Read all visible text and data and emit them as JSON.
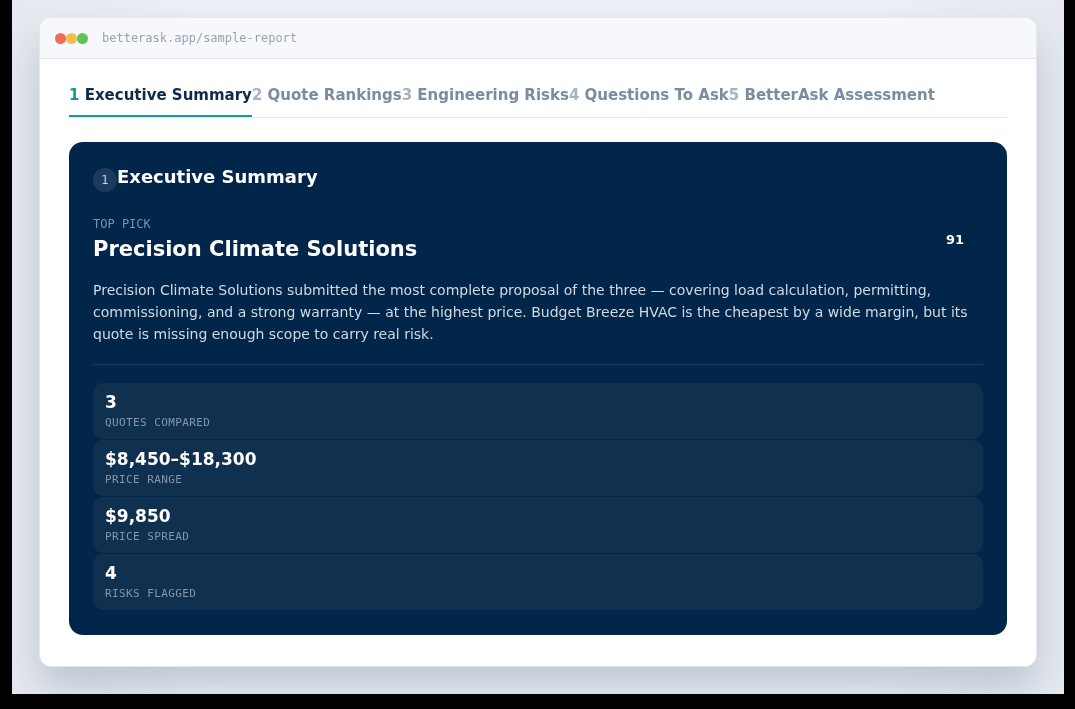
{
  "browser": {
    "url": "betterask.app/sample-report"
  },
  "tabs": [
    {
      "number": "1",
      "label": "Executive Summary",
      "selected": true
    },
    {
      "number": "2",
      "label": "Quote Rankings",
      "selected": false
    },
    {
      "number": "3",
      "label": "Engineering Risks",
      "selected": false
    },
    {
      "number": "4",
      "label": "Questions To Ask",
      "selected": false
    },
    {
      "number": "5",
      "label": "BetterAsk Assessment",
      "selected": false
    }
  ],
  "section": {
    "number": "1",
    "title": "Executive Summary",
    "top_pick": {
      "eyebrow": "TOP PICK",
      "name": "Precision Climate Solutions",
      "score": "91"
    },
    "summary": "Precision Climate Solutions submitted the most complete proposal of the three — covering load calculation, permitting, commissioning, and a strong warranty — at the highest price. Budget Breeze HVAC is the cheapest by a wide margin, but its quote is missing enough scope to carry real risk.",
    "stats": [
      {
        "value": "3",
        "label": "QUOTES COMPARED"
      },
      {
        "value": "$8,450–$18,300",
        "label": "PRICE RANGE"
      },
      {
        "value": "$9,850",
        "label": "PRICE SPREAD"
      },
      {
        "value": "4",
        "label": "RISKS FLAGGED"
      }
    ]
  }
}
